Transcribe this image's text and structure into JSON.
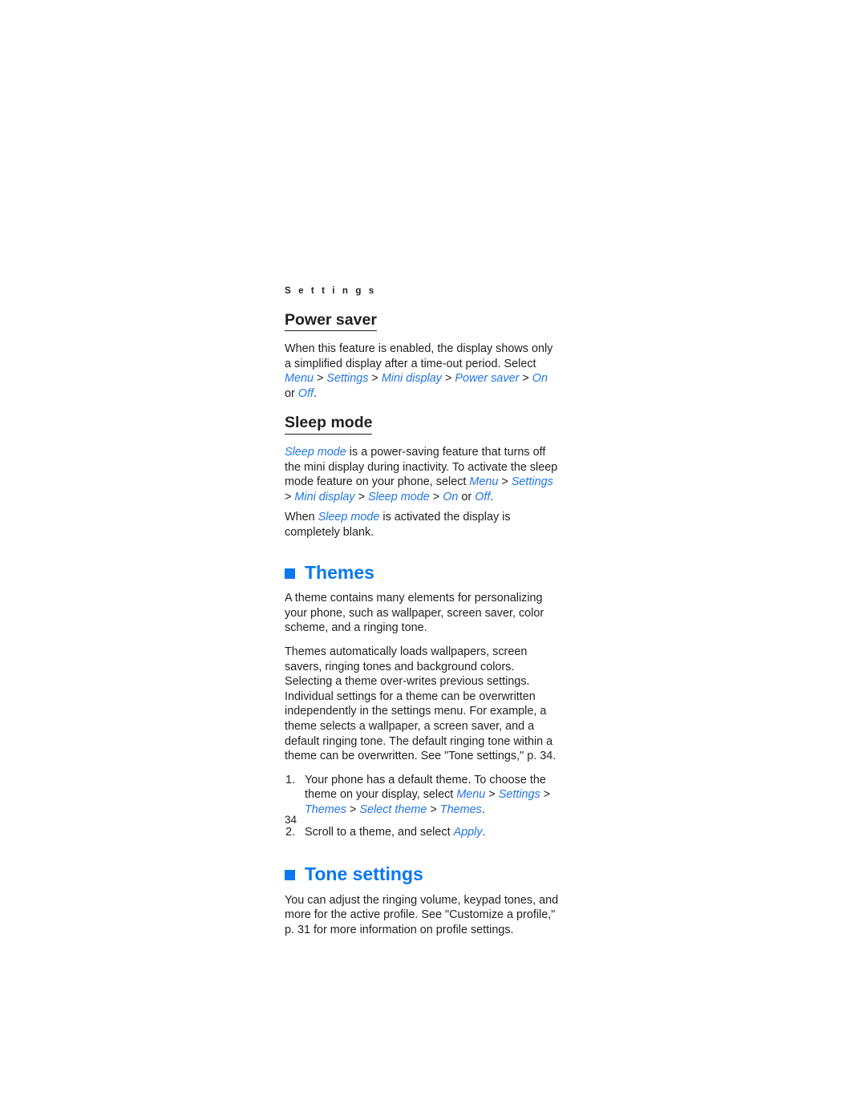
{
  "document": {
    "running_head": "S e t t i n g s",
    "page_number": "34",
    "accent_color": "#0a78f0",
    "link_color": "#2176e0",
    "text_color": "#231f20",
    "background_color": "#ffffff"
  },
  "sections": {
    "power_saver": {
      "heading": "Power saver",
      "paragraph_plain": "When this feature is enabled, the display shows only a simplified display after a time-out period. Select ",
      "path": {
        "menu": "Menu",
        "settings": "Settings",
        "mini_display": "Mini display",
        "power_saver": "Power saver",
        "on": "On",
        "off": "Off",
        "separator": ">",
        "or": " or ",
        "period": "."
      }
    },
    "sleep_mode": {
      "heading": "Sleep mode",
      "p1_a": "Sleep mode",
      "p1_b": " is a power-saving feature that turns off the mini display during inactivity. To activate the sleep mode feature on your phone, select ",
      "path": {
        "menu": "Menu",
        "settings": "Settings",
        "mini_display": "Mini display",
        "sleep_mode": "Sleep mode",
        "on": "On",
        "off": "Off",
        "separator": ">",
        "or": " or ",
        "period": "."
      },
      "p2_a": "When ",
      "p2_b": "Sleep mode",
      "p2_c": " is activated the display is completely blank."
    },
    "themes": {
      "heading": "Themes",
      "bullet_icon": "blue-square-bullet",
      "p1": "A theme contains many elements for personalizing your phone, such as wallpaper, screen saver, color scheme, and a ringing tone.",
      "p2": "Themes automatically loads wallpapers, screen savers, ringing tones and background colors. Selecting a theme over-writes previous settings. Individual settings for a theme can be overwritten independently in the settings menu. For example, a theme selects a wallpaper, a screen saver, and a default ringing tone. The default ringing tone within a theme can be overwritten. See \"Tone settings,\" p. 34.",
      "steps": [
        {
          "number": "1.",
          "text_a": "Your phone has a default theme. To choose the theme on your display, select ",
          "path": {
            "menu": "Menu",
            "settings": "Settings",
            "themes": "Themes",
            "select_theme": "Select theme",
            "themes2": "Themes",
            "separator": ">",
            "period": "."
          }
        },
        {
          "number": "2.",
          "text_a": "Scroll to a theme, and select ",
          "apply": "Apply",
          "period": "."
        }
      ]
    },
    "tone_settings": {
      "heading": "Tone settings",
      "bullet_icon": "blue-square-bullet",
      "p1": "You can adjust the ringing volume, keypad tones, and more for the active profile. See \"Customize a profile,\" p. 31 for more information on profile settings."
    }
  }
}
